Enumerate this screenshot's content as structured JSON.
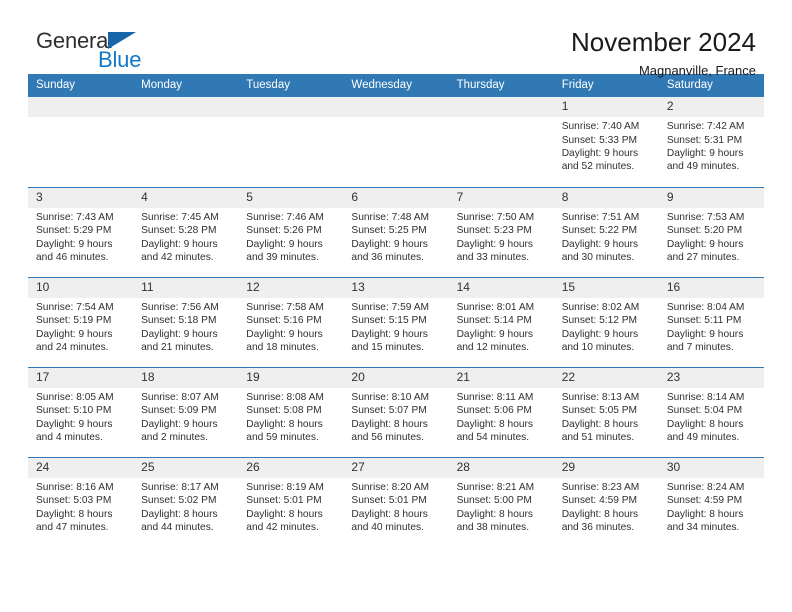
{
  "brand": {
    "word_one": "General",
    "word_two": "Blue",
    "triangle_color": "#1565a8",
    "blue_color": "#1278c8"
  },
  "header": {
    "title": "November 2024",
    "subtitle": "Magnanville, France"
  },
  "theme": {
    "header_band": "#3079b5",
    "daynum_band": "#efefef",
    "row_rule": "#3079b5"
  },
  "weekday_headers": [
    "Sunday",
    "Monday",
    "Tuesday",
    "Wednesday",
    "Thursday",
    "Friday",
    "Saturday"
  ],
  "labels": {
    "sunrise_prefix": "Sunrise:",
    "sunset_prefix": "Sunset:",
    "daylight_prefix": "Daylight:"
  },
  "weeks": [
    [
      {
        "day": "",
        "empty": true
      },
      {
        "day": "",
        "empty": true
      },
      {
        "day": "",
        "empty": true
      },
      {
        "day": "",
        "empty": true
      },
      {
        "day": "",
        "empty": true
      },
      {
        "day": "1",
        "sunrise": "Sunrise: 7:40 AM",
        "sunset": "Sunset: 5:33 PM",
        "daylight_line1": "Daylight: 9 hours",
        "daylight_line2": "and 52 minutes."
      },
      {
        "day": "2",
        "sunrise": "Sunrise: 7:42 AM",
        "sunset": "Sunset: 5:31 PM",
        "daylight_line1": "Daylight: 9 hours",
        "daylight_line2": "and 49 minutes."
      }
    ],
    [
      {
        "day": "3",
        "sunrise": "Sunrise: 7:43 AM",
        "sunset": "Sunset: 5:29 PM",
        "daylight_line1": "Daylight: 9 hours",
        "daylight_line2": "and 46 minutes."
      },
      {
        "day": "4",
        "sunrise": "Sunrise: 7:45 AM",
        "sunset": "Sunset: 5:28 PM",
        "daylight_line1": "Daylight: 9 hours",
        "daylight_line2": "and 42 minutes."
      },
      {
        "day": "5",
        "sunrise": "Sunrise: 7:46 AM",
        "sunset": "Sunset: 5:26 PM",
        "daylight_line1": "Daylight: 9 hours",
        "daylight_line2": "and 39 minutes."
      },
      {
        "day": "6",
        "sunrise": "Sunrise: 7:48 AM",
        "sunset": "Sunset: 5:25 PM",
        "daylight_line1": "Daylight: 9 hours",
        "daylight_line2": "and 36 minutes."
      },
      {
        "day": "7",
        "sunrise": "Sunrise: 7:50 AM",
        "sunset": "Sunset: 5:23 PM",
        "daylight_line1": "Daylight: 9 hours",
        "daylight_line2": "and 33 minutes."
      },
      {
        "day": "8",
        "sunrise": "Sunrise: 7:51 AM",
        "sunset": "Sunset: 5:22 PM",
        "daylight_line1": "Daylight: 9 hours",
        "daylight_line2": "and 30 minutes."
      },
      {
        "day": "9",
        "sunrise": "Sunrise: 7:53 AM",
        "sunset": "Sunset: 5:20 PM",
        "daylight_line1": "Daylight: 9 hours",
        "daylight_line2": "and 27 minutes."
      }
    ],
    [
      {
        "day": "10",
        "sunrise": "Sunrise: 7:54 AM",
        "sunset": "Sunset: 5:19 PM",
        "daylight_line1": "Daylight: 9 hours",
        "daylight_line2": "and 24 minutes."
      },
      {
        "day": "11",
        "sunrise": "Sunrise: 7:56 AM",
        "sunset": "Sunset: 5:18 PM",
        "daylight_line1": "Daylight: 9 hours",
        "daylight_line2": "and 21 minutes."
      },
      {
        "day": "12",
        "sunrise": "Sunrise: 7:58 AM",
        "sunset": "Sunset: 5:16 PM",
        "daylight_line1": "Daylight: 9 hours",
        "daylight_line2": "and 18 minutes."
      },
      {
        "day": "13",
        "sunrise": "Sunrise: 7:59 AM",
        "sunset": "Sunset: 5:15 PM",
        "daylight_line1": "Daylight: 9 hours",
        "daylight_line2": "and 15 minutes."
      },
      {
        "day": "14",
        "sunrise": "Sunrise: 8:01 AM",
        "sunset": "Sunset: 5:14 PM",
        "daylight_line1": "Daylight: 9 hours",
        "daylight_line2": "and 12 minutes."
      },
      {
        "day": "15",
        "sunrise": "Sunrise: 8:02 AM",
        "sunset": "Sunset: 5:12 PM",
        "daylight_line1": "Daylight: 9 hours",
        "daylight_line2": "and 10 minutes."
      },
      {
        "day": "16",
        "sunrise": "Sunrise: 8:04 AM",
        "sunset": "Sunset: 5:11 PM",
        "daylight_line1": "Daylight: 9 hours",
        "daylight_line2": "and 7 minutes."
      }
    ],
    [
      {
        "day": "17",
        "sunrise": "Sunrise: 8:05 AM",
        "sunset": "Sunset: 5:10 PM",
        "daylight_line1": "Daylight: 9 hours",
        "daylight_line2": "and 4 minutes."
      },
      {
        "day": "18",
        "sunrise": "Sunrise: 8:07 AM",
        "sunset": "Sunset: 5:09 PM",
        "daylight_line1": "Daylight: 9 hours",
        "daylight_line2": "and 2 minutes."
      },
      {
        "day": "19",
        "sunrise": "Sunrise: 8:08 AM",
        "sunset": "Sunset: 5:08 PM",
        "daylight_line1": "Daylight: 8 hours",
        "daylight_line2": "and 59 minutes."
      },
      {
        "day": "20",
        "sunrise": "Sunrise: 8:10 AM",
        "sunset": "Sunset: 5:07 PM",
        "daylight_line1": "Daylight: 8 hours",
        "daylight_line2": "and 56 minutes."
      },
      {
        "day": "21",
        "sunrise": "Sunrise: 8:11 AM",
        "sunset": "Sunset: 5:06 PM",
        "daylight_line1": "Daylight: 8 hours",
        "daylight_line2": "and 54 minutes."
      },
      {
        "day": "22",
        "sunrise": "Sunrise: 8:13 AM",
        "sunset": "Sunset: 5:05 PM",
        "daylight_line1": "Daylight: 8 hours",
        "daylight_line2": "and 51 minutes."
      },
      {
        "day": "23",
        "sunrise": "Sunrise: 8:14 AM",
        "sunset": "Sunset: 5:04 PM",
        "daylight_line1": "Daylight: 8 hours",
        "daylight_line2": "and 49 minutes."
      }
    ],
    [
      {
        "day": "24",
        "sunrise": "Sunrise: 8:16 AM",
        "sunset": "Sunset: 5:03 PM",
        "daylight_line1": "Daylight: 8 hours",
        "daylight_line2": "and 47 minutes."
      },
      {
        "day": "25",
        "sunrise": "Sunrise: 8:17 AM",
        "sunset": "Sunset: 5:02 PM",
        "daylight_line1": "Daylight: 8 hours",
        "daylight_line2": "and 44 minutes."
      },
      {
        "day": "26",
        "sunrise": "Sunrise: 8:19 AM",
        "sunset": "Sunset: 5:01 PM",
        "daylight_line1": "Daylight: 8 hours",
        "daylight_line2": "and 42 minutes."
      },
      {
        "day": "27",
        "sunrise": "Sunrise: 8:20 AM",
        "sunset": "Sunset: 5:01 PM",
        "daylight_line1": "Daylight: 8 hours",
        "daylight_line2": "and 40 minutes."
      },
      {
        "day": "28",
        "sunrise": "Sunrise: 8:21 AM",
        "sunset": "Sunset: 5:00 PM",
        "daylight_line1": "Daylight: 8 hours",
        "daylight_line2": "and 38 minutes."
      },
      {
        "day": "29",
        "sunrise": "Sunrise: 8:23 AM",
        "sunset": "Sunset: 4:59 PM",
        "daylight_line1": "Daylight: 8 hours",
        "daylight_line2": "and 36 minutes."
      },
      {
        "day": "30",
        "sunrise": "Sunrise: 8:24 AM",
        "sunset": "Sunset: 4:59 PM",
        "daylight_line1": "Daylight: 8 hours",
        "daylight_line2": "and 34 minutes."
      }
    ]
  ]
}
